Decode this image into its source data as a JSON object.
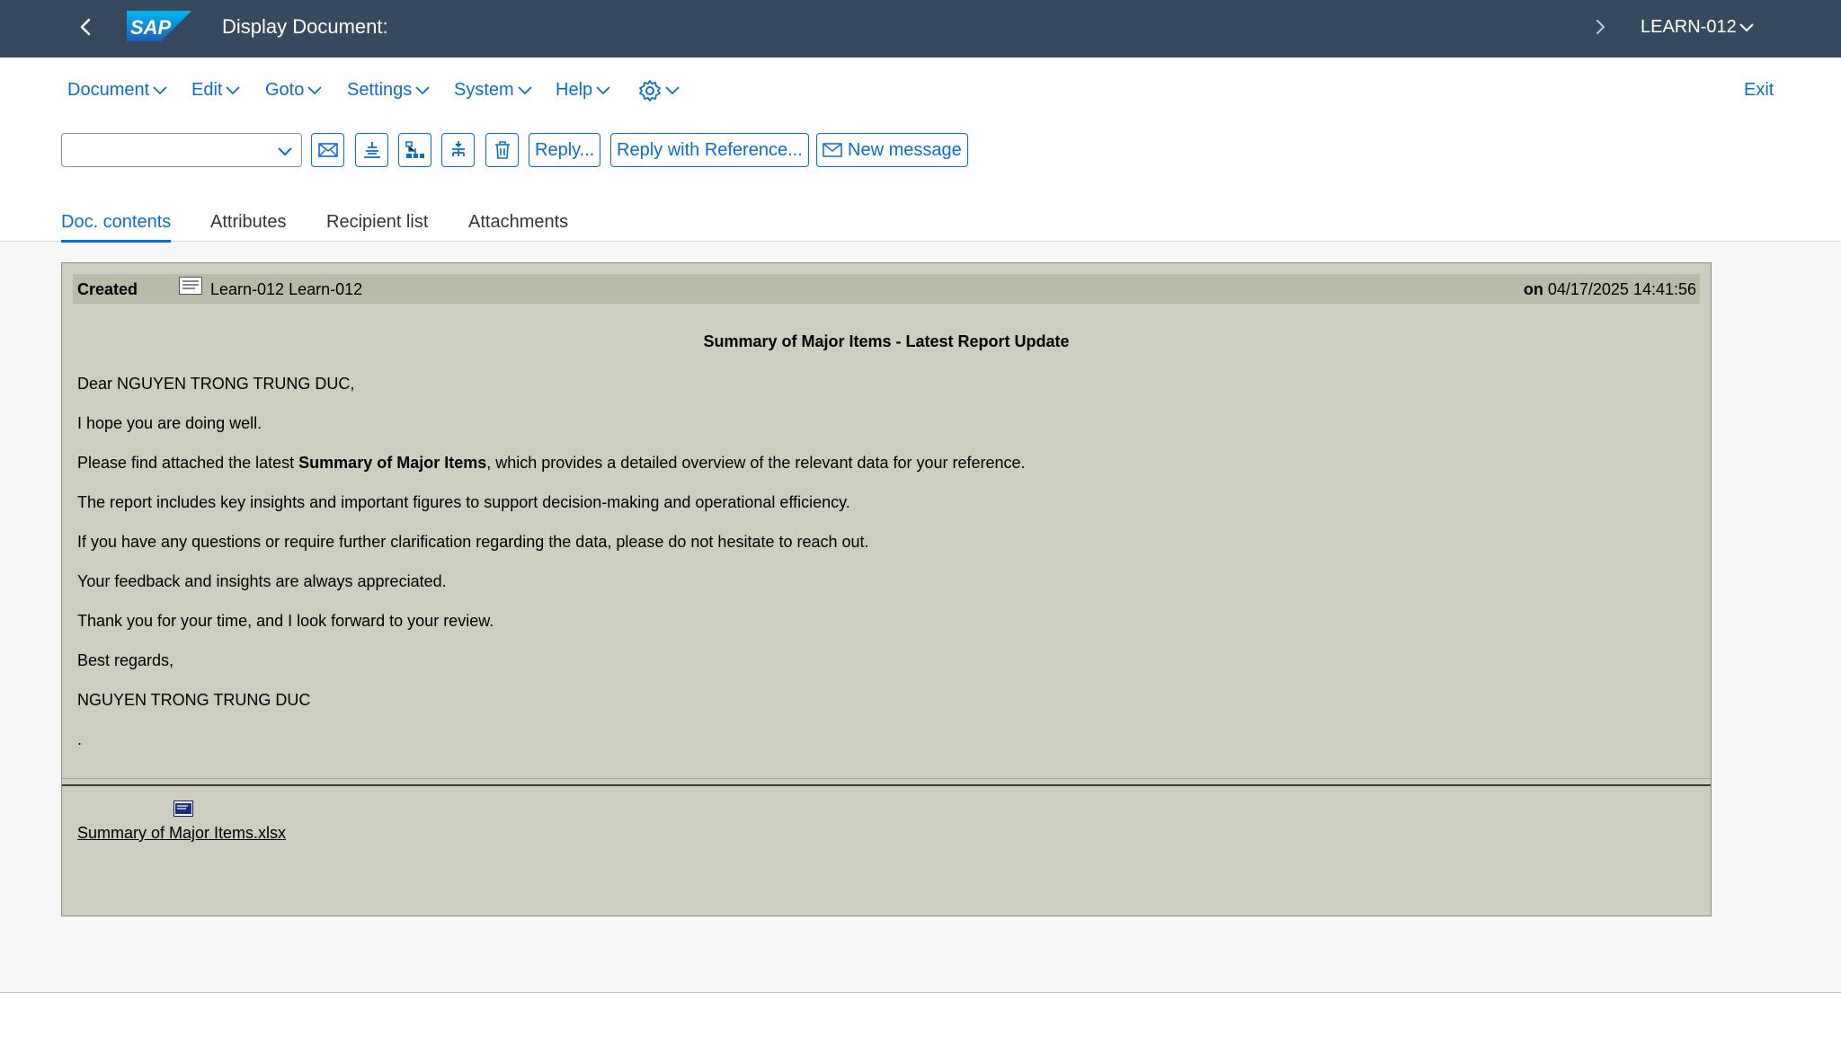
{
  "shell": {
    "title": "Display Document:",
    "system": "LEARN-012",
    "logo_text": "SAP"
  },
  "menu": {
    "items": [
      "Document",
      "Edit",
      "Goto",
      "Settings",
      "System",
      "Help"
    ],
    "exit": "Exit"
  },
  "toolbar": {
    "combo_value": "",
    "reply": "Reply...",
    "reply_ref": "Reply with Reference...",
    "new_message": "New message"
  },
  "tabs": [
    "Doc. contents",
    "Attributes",
    "Recipient list",
    "Attachments"
  ],
  "document": {
    "created_label": "Created",
    "author": "Learn-012 Learn-012",
    "on_label": "on",
    "datetime": "04/17/2025 14:41:56",
    "subject": "Summary of Major Items - Latest Report Update",
    "greeting": "Dear NGUYEN TRONG TRUNG DUC,",
    "line1": "I hope you are doing well.",
    "line2_pre": "Please find attached the latest ",
    "line2_bold": "Summary of Major Items",
    "line2_post": ", which provides a detailed overview of the relevant data for your reference.",
    "line3": "The report includes key insights and important figures to support decision-making and operational efficiency.",
    "line4": "If you have any questions or require further clarification regarding the data, please do not hesitate to reach out.",
    "line5": "Your feedback and insights are always appreciated.",
    "line6": "Thank you for your time, and I look forward to your review.",
    "closing": "Best regards,",
    "signature": "NGUYEN TRONG TRUNG DUC",
    "dot": ".",
    "attachment": "Summary of Major Items.xlsx"
  },
  "colors": {
    "shell_bg": "#354a5f",
    "accent": "#0a6ed1",
    "doc_bg": "#cdcdc0",
    "doc_header_bg": "#babaa8"
  }
}
